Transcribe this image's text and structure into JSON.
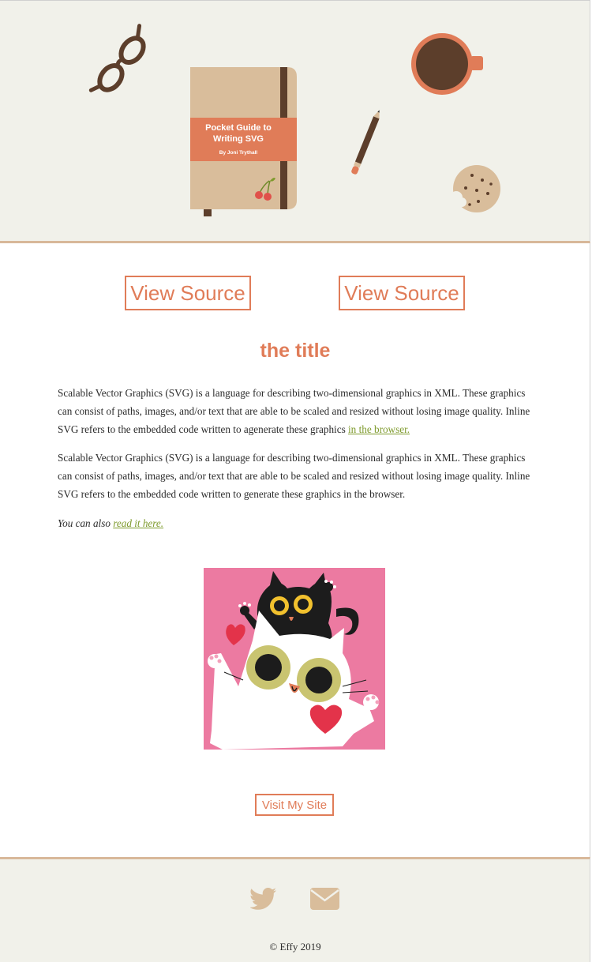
{
  "book": {
    "title_line1": "Pocket Guide to",
    "title_line2": "Writing SVG",
    "author": "By Joni Trythall"
  },
  "actions": {
    "view_source_1": "View Source",
    "view_source_2": "View Source",
    "visit_site": "Visit My Site"
  },
  "article": {
    "title": "the title",
    "p1_text": "Scalable Vector Graphics (SVG) is a language for describing two-dimensional graphics in XML. These graphics can consist of paths, images, and/or text that are able to be scaled and resized without losing image quality. Inline SVG refers to the embedded code written to agenerate these graphics ",
    "p1_link": "in the browser.",
    "p2_text": "Scalable Vector Graphics (SVG) is a language for describing two-dimensional graphics in XML. These graphics can consist of paths, images, and/or text that are able to be scaled and resized without losing image quality. Inline SVG refers to the embedded code written to generate these graphics in the browser.",
    "p3_text": "You can also ",
    "p3_link": "read it here."
  },
  "footer": {
    "twitter_icon": "twitter-icon",
    "email_icon": "envelope-icon",
    "copyright": "© Effy 2019"
  },
  "colors": {
    "accent": "#e07c58",
    "link": "#7e9a2c",
    "tan": "#d8b89a",
    "brown": "#5c3e2b",
    "pink": "#ec7aa1",
    "hero_bg": "#f1f1ea"
  }
}
